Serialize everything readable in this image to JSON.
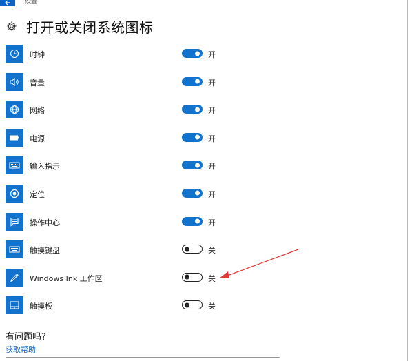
{
  "window": {
    "title": "设置"
  },
  "page": {
    "title": "打开或关闭系统图标"
  },
  "items": [
    {
      "label": "时钟",
      "state": "开",
      "on": true,
      "icon": "clock-icon"
    },
    {
      "label": "音量",
      "state": "开",
      "on": true,
      "icon": "volume-icon"
    },
    {
      "label": "网络",
      "state": "开",
      "on": true,
      "icon": "network-icon"
    },
    {
      "label": "电源",
      "state": "开",
      "on": true,
      "icon": "battery-icon"
    },
    {
      "label": "输入指示",
      "state": "开",
      "on": true,
      "icon": "keyboard-icon"
    },
    {
      "label": "定位",
      "state": "开",
      "on": true,
      "icon": "location-icon"
    },
    {
      "label": "操作中心",
      "state": "开",
      "on": true,
      "icon": "action-center-icon"
    },
    {
      "label": "触摸键盘",
      "state": "关",
      "on": false,
      "icon": "touch-keyboard-icon"
    },
    {
      "label": "Windows Ink 工作区",
      "state": "关",
      "on": false,
      "icon": "pen-icon"
    },
    {
      "label": "触摸板",
      "state": "关",
      "on": false,
      "icon": "touchpad-icon"
    }
  ],
  "help": {
    "question": "有问题吗?",
    "link": "获取帮助"
  },
  "colors": {
    "accent": "#1272cc",
    "arrow": "#e0393a",
    "link": "#1565c0"
  }
}
